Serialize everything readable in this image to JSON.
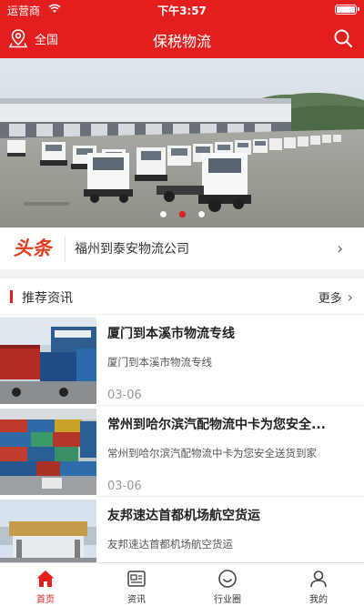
{
  "status_bar": {
    "carrier": "运营商",
    "time": "下午3:57"
  },
  "header": {
    "location": "全国",
    "title": "保税物流"
  },
  "banner": {
    "slide_count": 3,
    "active_index": 1
  },
  "headline": {
    "badge": "头条",
    "text": "福州到泰安物流公司"
  },
  "recommended": {
    "title": "推荐资讯",
    "more_label": "更多",
    "items": [
      {
        "title": "厦门到本溪市物流专线",
        "desc": "厦门到本溪市物流专线",
        "date": "03-06"
      },
      {
        "title": "常州到哈尔滨汽配物流中卡为您安全...",
        "desc": "常州到哈尔滨汽配物流中卡为您安全送货到家",
        "date": "03-06"
      },
      {
        "title": "友邦速达首都机场航空货运",
        "desc": "友邦速达首都机场航空货运",
        "date": ""
      }
    ]
  },
  "tabbar": {
    "tabs": [
      {
        "label": "首页",
        "icon": "home-icon",
        "active": true
      },
      {
        "label": "资讯",
        "icon": "news-icon",
        "active": false
      },
      {
        "label": "行业圈",
        "icon": "circle-icon",
        "active": false
      },
      {
        "label": "我的",
        "icon": "user-icon",
        "active": false
      }
    ]
  },
  "colors": {
    "brand": "#e21e1e",
    "headline_badge": "#e53c1e",
    "background": "#f2f2f2"
  }
}
